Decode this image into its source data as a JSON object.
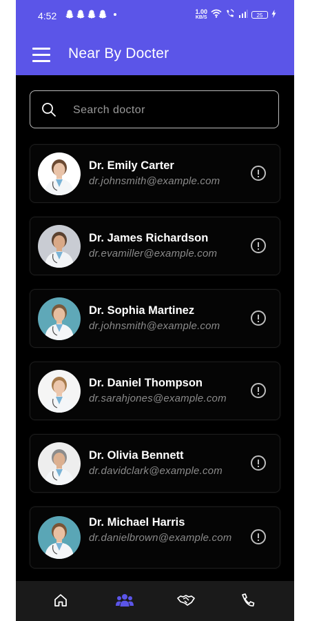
{
  "status_bar": {
    "time": "4:52",
    "net_speed_value": "1.00",
    "net_speed_unit": "KB/S",
    "battery": "25"
  },
  "app_bar": {
    "title": "Near By Docter",
    "menu_icon": "hamburger-menu-icon"
  },
  "search": {
    "placeholder": "Search doctor",
    "value": "",
    "icon": "search-icon"
  },
  "doctors": [
    {
      "name": "Dr. Emily Carter",
      "email": "dr.johnsmith@example.com",
      "avatar_bg": "#ffffff",
      "coat": "#f4f6f8",
      "skin": "#e9c3a8",
      "hair": "#6b4a32"
    },
    {
      "name": "Dr. James Richardson",
      "email": "dr.evamiller@example.com",
      "avatar_bg": "#c9ccd3",
      "coat": "#f2f4f6",
      "skin": "#d9a987",
      "hair": "#5a4230"
    },
    {
      "name": "Dr. Sophia Martinez",
      "email": "dr.johnsmith@example.com",
      "avatar_bg": "#5fa8b8",
      "coat": "#f4f6f8",
      "skin": "#e6bea0",
      "hair": "#7a5a3c"
    },
    {
      "name": "Dr. Daniel Thompson",
      "email": "dr.sarahjones@example.com",
      "avatar_bg": "#f5f5f5",
      "coat": "#f4f6f8",
      "skin": "#ecc7ad",
      "hair": "#a87c4d"
    },
    {
      "name": "Dr. Olivia Bennett",
      "email": "dr.davidclark@example.com",
      "avatar_bg": "#eeeeee",
      "coat": "#f4f6f8",
      "skin": "#dcb090",
      "hair": "#8c8c8c"
    },
    {
      "name": "Dr. Michael Harris",
      "email": "dr.danielbrown@example.com",
      "avatar_bg": "#5aa6b6",
      "coat": "#f4f6f8",
      "skin": "#e9c0a2",
      "hair": "#7a5436"
    }
  ],
  "bottom_nav": {
    "items": [
      {
        "icon": "home-icon",
        "active": false
      },
      {
        "icon": "group-icon",
        "active": true
      },
      {
        "icon": "handshake-icon",
        "active": false
      },
      {
        "icon": "phone-icon",
        "active": false
      }
    ]
  },
  "colors": {
    "primary": "#5B55E8",
    "background": "#000000",
    "nav_active": "#5B55E8",
    "nav_inactive": "#ffffff"
  }
}
